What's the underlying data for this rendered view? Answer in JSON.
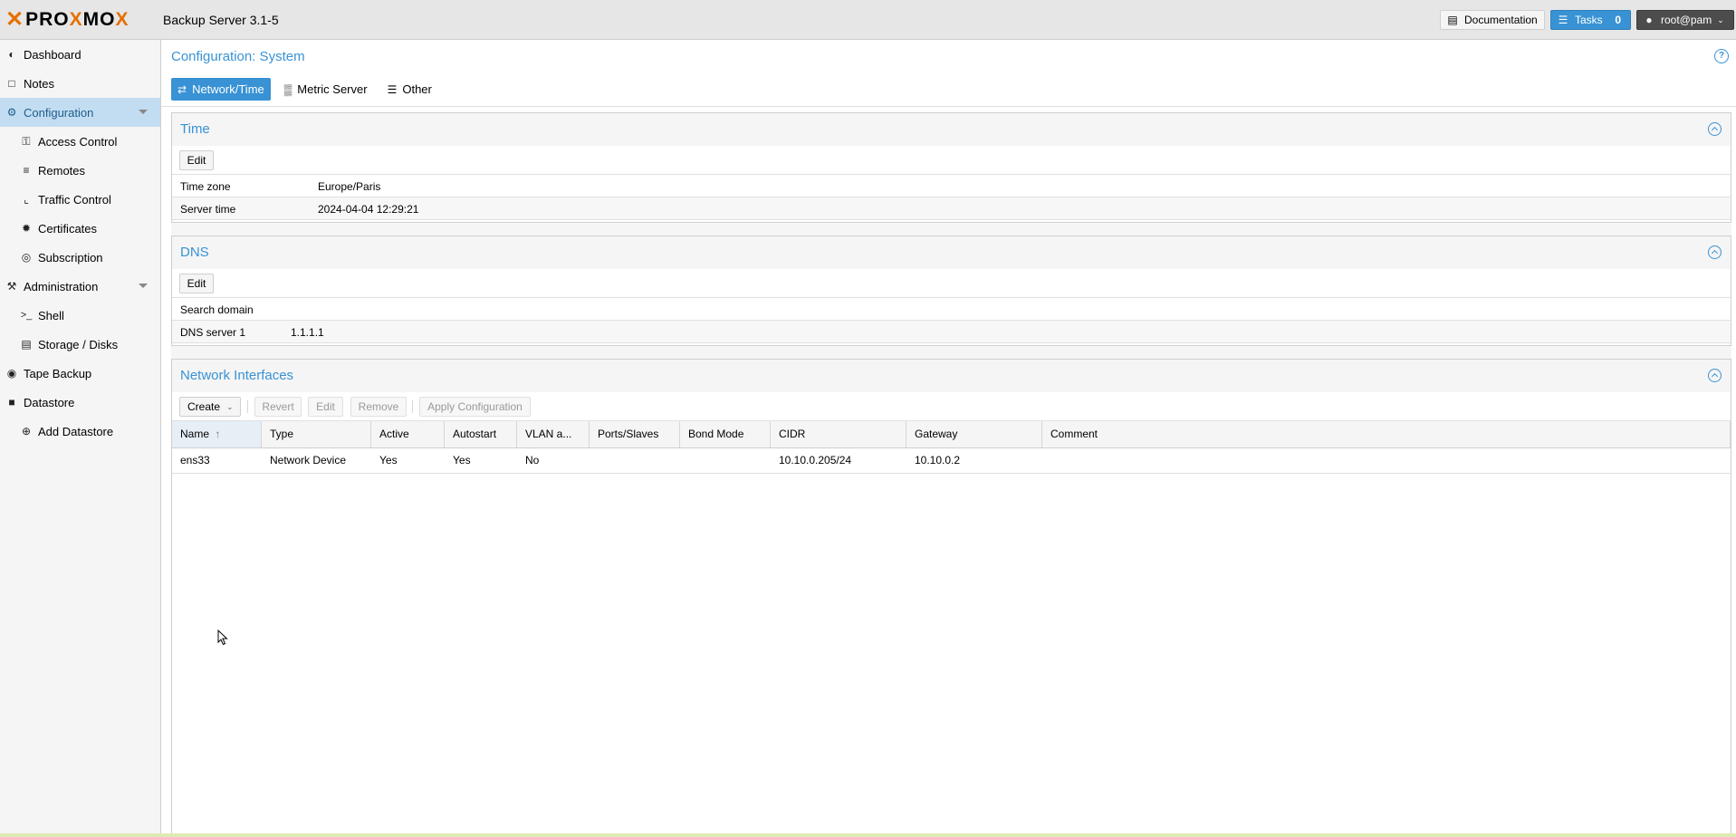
{
  "topbar": {
    "logo_text": "PROXMOX",
    "product": "Backup Server 3.1-5",
    "documentation_label": "Documentation",
    "tasks_label": "Tasks",
    "tasks_count": "0",
    "user_label": "root@pam"
  },
  "sidebar": {
    "items": [
      {
        "label": "Dashboard",
        "icon": "dashboard-icon"
      },
      {
        "label": "Notes",
        "icon": "notes-icon"
      },
      {
        "label": "Configuration",
        "icon": "gears-icon"
      },
      {
        "label": "Access Control",
        "icon": "key-icon"
      },
      {
        "label": "Remotes",
        "icon": "server-icon"
      },
      {
        "label": "Traffic Control",
        "icon": "chart-icon"
      },
      {
        "label": "Certificates",
        "icon": "certificate-icon"
      },
      {
        "label": "Subscription",
        "icon": "support-icon"
      },
      {
        "label": "Administration",
        "icon": "wrench-icon"
      },
      {
        "label": "Shell",
        "icon": "terminal-icon"
      },
      {
        "label": "Storage / Disks",
        "icon": "hdd-icon"
      },
      {
        "label": "Tape Backup",
        "icon": "tape-icon"
      },
      {
        "label": "Datastore",
        "icon": "archive-icon"
      },
      {
        "label": "Add Datastore",
        "icon": "plus-circle-icon"
      }
    ]
  },
  "main": {
    "title": "Configuration: System",
    "tabs": [
      {
        "label": "Network/Time"
      },
      {
        "label": "Metric Server"
      },
      {
        "label": "Other"
      }
    ]
  },
  "time_panel": {
    "title": "Time",
    "edit_label": "Edit",
    "rows": [
      {
        "key": "Time zone",
        "value": "Europe/Paris"
      },
      {
        "key": "Server time",
        "value": "2024-04-04 12:29:21"
      }
    ]
  },
  "dns_panel": {
    "title": "DNS",
    "edit_label": "Edit",
    "rows": [
      {
        "key": "Search domain",
        "value": ""
      },
      {
        "key": "DNS server 1",
        "value": "1.1.1.1"
      }
    ]
  },
  "network_panel": {
    "title": "Network Interfaces",
    "toolbar": {
      "create": "Create",
      "revert": "Revert",
      "edit": "Edit",
      "remove": "Remove",
      "apply": "Apply Configuration"
    },
    "columns": [
      "Name",
      "Type",
      "Active",
      "Autostart",
      "VLAN a...",
      "Ports/Slaves",
      "Bond Mode",
      "CIDR",
      "Gateway",
      "Comment"
    ],
    "rows": [
      [
        "ens33",
        "Network Device",
        "Yes",
        "Yes",
        "No",
        "",
        "",
        "10.10.0.205/24",
        "10.10.0.2",
        ""
      ]
    ]
  },
  "colors": {
    "accent": "#3892d4",
    "logo_orange": "#e57000",
    "selected_nav": "#c2ddf2"
  }
}
